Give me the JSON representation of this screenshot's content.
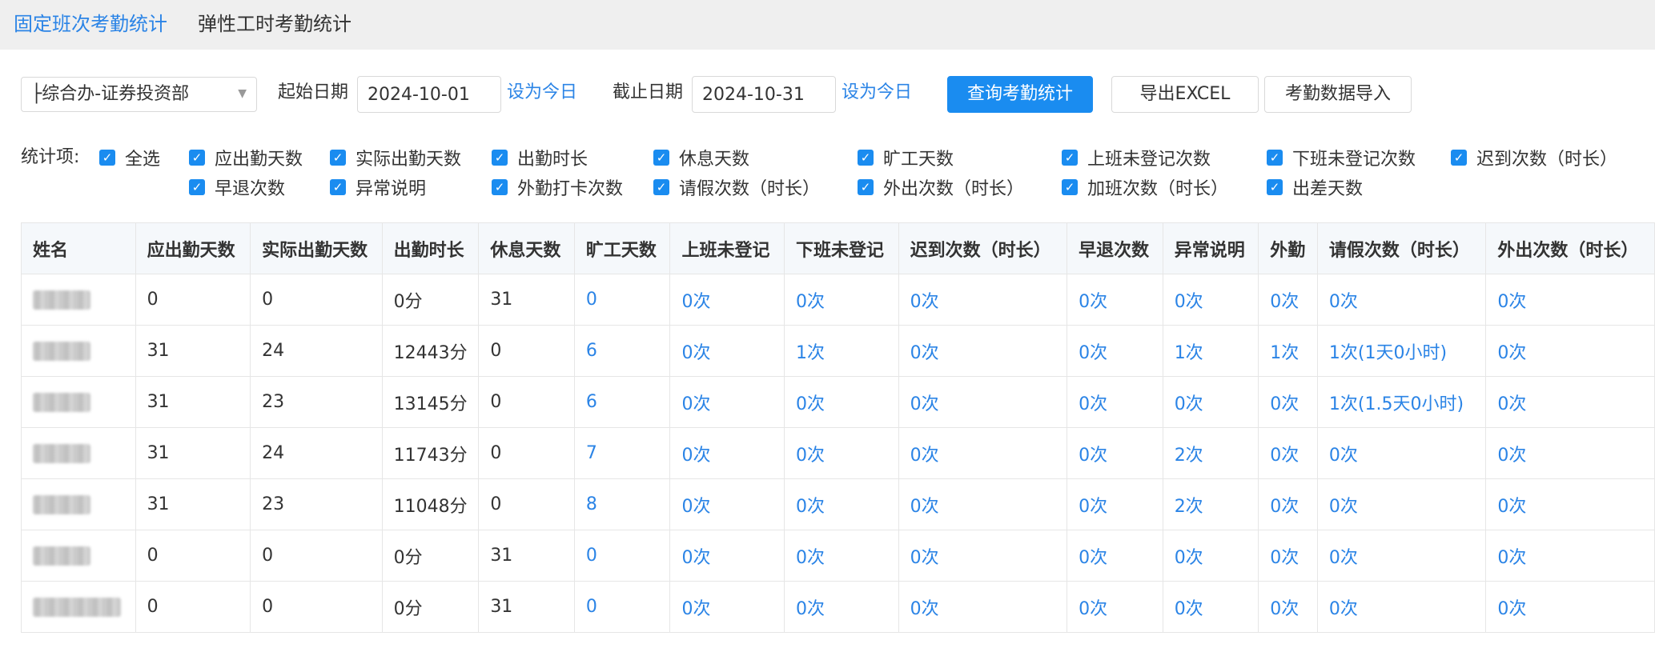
{
  "tabs": [
    {
      "label": "固定班次考勤统计",
      "active": true
    },
    {
      "label": "弹性工时考勤统计",
      "active": false
    }
  ],
  "filters": {
    "department": "├综合办-证券投资部",
    "start_label": "起始日期",
    "start_date": "2024-10-01",
    "set_today_1": "设为今日",
    "end_label": "截止日期",
    "end_date": "2024-10-31",
    "set_today_2": "设为今日",
    "query_button": "查询考勤统计",
    "export_button": "导出EXCEL",
    "import_button": "考勤数据导入"
  },
  "stats": {
    "label": "统计项:",
    "items": [
      "全选",
      "应出勤天数",
      "实际出勤天数",
      "出勤时长",
      "休息天数",
      "旷工天数",
      "上班未登记次数",
      "下班未登记次数",
      "迟到次数（时长）",
      "早退次数",
      "异常说明",
      "外勤打卡次数",
      "请假次数（时长）",
      "外出次数（时长）",
      "加班次数（时长）",
      "出差天数"
    ]
  },
  "table": {
    "headers": [
      "姓名",
      "应出勤天数",
      "实际出勤天数",
      "出勤时长",
      "休息天数",
      "旷工天数",
      "上班未登记",
      "下班未登记",
      "迟到次数（时长）",
      "早退次数",
      "异常说明",
      "外勤",
      "请假次数（时长）",
      "外出次数（时长）"
    ],
    "rows": [
      {
        "cells": [
          "0",
          "0",
          "0分",
          "31",
          "0",
          "0次",
          "0次",
          "0次",
          "0次",
          "0次",
          "0次",
          "0次",
          "0次"
        ]
      },
      {
        "cells": [
          "31",
          "24",
          "12443分",
          "0",
          "6",
          "0次",
          "1次",
          "0次",
          "0次",
          "1次",
          "1次",
          "1次(1天0小时)",
          "0次"
        ]
      },
      {
        "cells": [
          "31",
          "23",
          "13145分",
          "0",
          "6",
          "0次",
          "0次",
          "0次",
          "0次",
          "0次",
          "0次",
          "1次(1.5天0小时)",
          "0次"
        ]
      },
      {
        "cells": [
          "31",
          "24",
          "11743分",
          "0",
          "7",
          "0次",
          "0次",
          "0次",
          "0次",
          "2次",
          "0次",
          "0次",
          "0次"
        ]
      },
      {
        "cells": [
          "31",
          "23",
          "11048分",
          "0",
          "8",
          "0次",
          "0次",
          "0次",
          "0次",
          "2次",
          "0次",
          "0次",
          "0次"
        ]
      },
      {
        "cells": [
          "0",
          "0",
          "0分",
          "31",
          "0",
          "0次",
          "0次",
          "0次",
          "0次",
          "0次",
          "0次",
          "0次",
          "0次"
        ]
      },
      {
        "cells": [
          "0",
          "0",
          "0分",
          "31",
          "0",
          "0次",
          "0次",
          "0次",
          "0次",
          "0次",
          "0次",
          "0次",
          "0次"
        ]
      }
    ]
  },
  "colors": {
    "accent": "#2b84e6",
    "primary_button": "#1a8cf0",
    "header_bg": "#f5f8fb",
    "topbar_bg": "#efefef"
  }
}
